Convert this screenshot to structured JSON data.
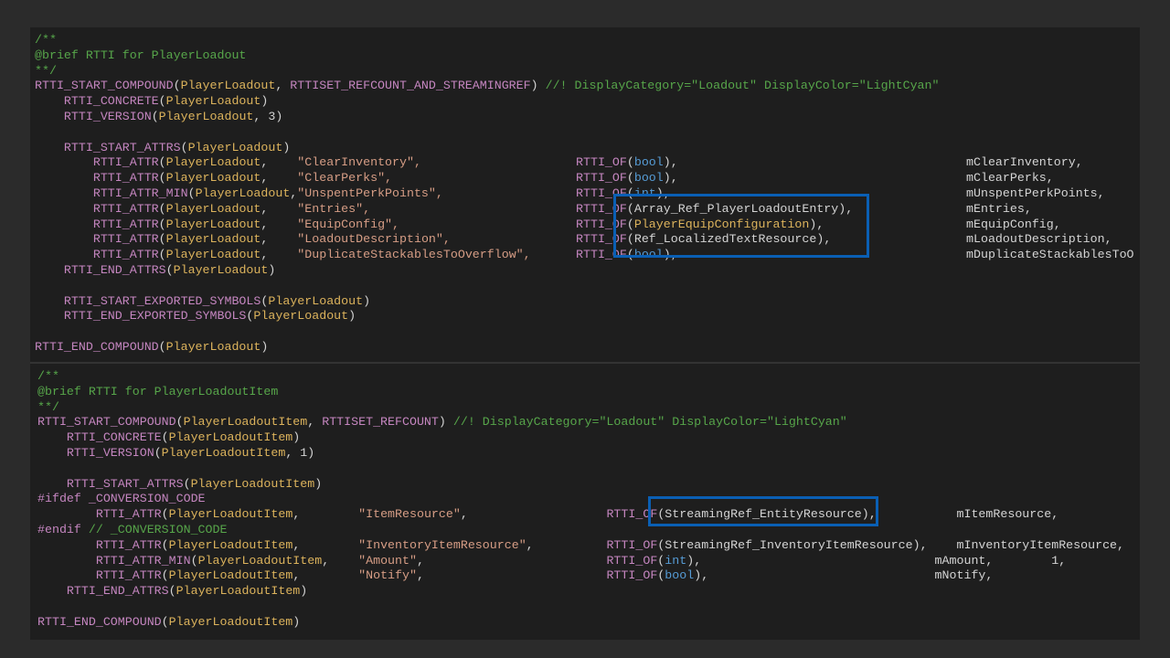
{
  "panel1": {
    "l1": "/**",
    "l2": "@brief RTTI for PlayerLoadout",
    "l3": "**/",
    "l4": [
      {
        "c": "m",
        "t": "RTTI_START_COMPOUND"
      },
      {
        "c": "p",
        "t": "("
      },
      {
        "c": "t",
        "t": "PlayerLoadout"
      },
      {
        "c": "p",
        "t": ", "
      },
      {
        "c": "m",
        "t": "RTTISET_REFCOUNT_AND_STREAMINGREF"
      },
      {
        "c": "p",
        "t": ") "
      },
      {
        "c": "c",
        "t": "//! DisplayCategory=\"Loadout\" DisplayColor=\"LightCyan\""
      }
    ],
    "l5": [
      {
        "c": "p",
        "t": "    "
      },
      {
        "c": "m",
        "t": "RTTI_CONCRETE"
      },
      {
        "c": "p",
        "t": "("
      },
      {
        "c": "t",
        "t": "PlayerLoadout"
      },
      {
        "c": "p",
        "t": ")"
      }
    ],
    "l6": [
      {
        "c": "p",
        "t": "    "
      },
      {
        "c": "m",
        "t": "RTTI_VERSION"
      },
      {
        "c": "p",
        "t": "("
      },
      {
        "c": "t",
        "t": "PlayerLoadout"
      },
      {
        "c": "p",
        "t": ", 3)"
      }
    ],
    "l8": [
      {
        "c": "p",
        "t": "    "
      },
      {
        "c": "m",
        "t": "RTTI_START_ATTRS"
      },
      {
        "c": "p",
        "t": "("
      },
      {
        "c": "t",
        "t": "PlayerLoadout"
      },
      {
        "c": "p",
        "t": ")"
      }
    ],
    "rows": [
      {
        "macro": "RTTI_ATTR",
        "cls": "PlayerLoadout",
        "sep": ",    ",
        "name": "\"ClearInventory\",",
        "ofpre": "RTTI_OF",
        "type": "bool",
        "typecls": "k",
        "tail": "),",
        "member": "mClearInventory,"
      },
      {
        "macro": "RTTI_ATTR",
        "cls": "PlayerLoadout",
        "sep": ",    ",
        "name": "\"ClearPerks\",",
        "ofpre": "RTTI_OF",
        "type": "bool",
        "typecls": "k",
        "tail": "),",
        "member": "mClearPerks,"
      },
      {
        "macro": "RTTI_ATTR_MIN",
        "cls": "PlayerLoadout",
        "sep": ",",
        "name": "\"UnspentPerkPoints\",",
        "ofpre": "RTTI_OF",
        "type": "int",
        "typecls": "k",
        "tail": "),",
        "member": "mUnspentPerkPoints,"
      },
      {
        "macro": "RTTI_ATTR",
        "cls": "PlayerLoadout",
        "sep": ",    ",
        "name": "\"Entries\",",
        "ofpre": "RTTI_OF",
        "type": "Array_Ref_PlayerLoadoutEntry",
        "typecls": "n",
        "tail": "),",
        "member": "mEntries,"
      },
      {
        "macro": "RTTI_ATTR",
        "cls": "PlayerLoadout",
        "sep": ",    ",
        "name": "\"EquipConfig\",",
        "ofpre": "RTTI_OF",
        "type": "PlayerEquipConfiguration",
        "typecls": "t",
        "tail": "),",
        "member": "mEquipConfig,"
      },
      {
        "macro": "RTTI_ATTR",
        "cls": "PlayerLoadout",
        "sep": ",    ",
        "name": "\"LoadoutDescription\",",
        "ofpre": "RTTI_OF",
        "type": "Ref_LocalizedTextResource",
        "typecls": "n",
        "tail": "),",
        "member": "mLoadoutDescription,"
      },
      {
        "macro": "RTTI_ATTR",
        "cls": "PlayerLoadout",
        "sep": ",    ",
        "name": "\"DuplicateStackablesToOverflow\",",
        "ofpre": "RTTI_OF",
        "type": "bool",
        "typecls": "k",
        "tail": "),",
        "member": "mDuplicateStackablesToO"
      }
    ],
    "l16": [
      {
        "c": "p",
        "t": "    "
      },
      {
        "c": "m",
        "t": "RTTI_END_ATTRS"
      },
      {
        "c": "p",
        "t": "("
      },
      {
        "c": "t",
        "t": "PlayerLoadout"
      },
      {
        "c": "p",
        "t": ")"
      }
    ],
    "l18": [
      {
        "c": "p",
        "t": "    "
      },
      {
        "c": "m",
        "t": "RTTI_START_EXPORTED_SYMBOLS"
      },
      {
        "c": "p",
        "t": "("
      },
      {
        "c": "t",
        "t": "PlayerLoadout"
      },
      {
        "c": "p",
        "t": ")"
      }
    ],
    "l19": [
      {
        "c": "p",
        "t": "    "
      },
      {
        "c": "m",
        "t": "RTTI_END_EXPORTED_SYMBOLS"
      },
      {
        "c": "p",
        "t": "("
      },
      {
        "c": "t",
        "t": "PlayerLoadout"
      },
      {
        "c": "p",
        "t": ")"
      }
    ],
    "l21": [
      {
        "c": "m",
        "t": "RTTI_END_COMPOUND"
      },
      {
        "c": "p",
        "t": "("
      },
      {
        "c": "t",
        "t": "PlayerLoadout"
      },
      {
        "c": "p",
        "t": ")"
      }
    ]
  },
  "panel2": {
    "l1": "/**",
    "l2": "@brief RTTI for PlayerLoadoutItem",
    "l3": "**/",
    "l4": [
      {
        "c": "m",
        "t": "RTTI_START_COMPOUND"
      },
      {
        "c": "p",
        "t": "("
      },
      {
        "c": "t",
        "t": "PlayerLoadoutItem"
      },
      {
        "c": "p",
        "t": ", "
      },
      {
        "c": "m",
        "t": "RTTISET_REFCOUNT"
      },
      {
        "c": "p",
        "t": ") "
      },
      {
        "c": "c",
        "t": "//! DisplayCategory=\"Loadout\" DisplayColor=\"LightCyan\""
      }
    ],
    "l5": [
      {
        "c": "p",
        "t": "    "
      },
      {
        "c": "m",
        "t": "RTTI_CONCRETE"
      },
      {
        "c": "p",
        "t": "("
      },
      {
        "c": "t",
        "t": "PlayerLoadoutItem"
      },
      {
        "c": "p",
        "t": ")"
      }
    ],
    "l6": [
      {
        "c": "p",
        "t": "    "
      },
      {
        "c": "m",
        "t": "RTTI_VERSION"
      },
      {
        "c": "p",
        "t": "("
      },
      {
        "c": "t",
        "t": "PlayerLoadoutItem"
      },
      {
        "c": "p",
        "t": ", 1)"
      }
    ],
    "l8": [
      {
        "c": "p",
        "t": "    "
      },
      {
        "c": "m",
        "t": "RTTI_START_ATTRS"
      },
      {
        "c": "p",
        "t": "("
      },
      {
        "c": "t",
        "t": "PlayerLoadoutItem"
      },
      {
        "c": "p",
        "t": ")"
      }
    ],
    "l9": [
      {
        "c": "m",
        "t": "#ifdef "
      },
      {
        "c": "m",
        "t": "_CONVERSION_CODE"
      }
    ],
    "l10": [
      {
        "c": "p",
        "t": "        "
      },
      {
        "c": "m",
        "t": "RTTI_ATTR"
      },
      {
        "c": "p",
        "t": "("
      },
      {
        "c": "t",
        "t": "PlayerLoadoutItem"
      },
      {
        "c": "p",
        "t": ",        "
      },
      {
        "c": "s",
        "t": "\"ItemResource\""
      },
      {
        "c": "p",
        "t": ",                   "
      },
      {
        "c": "m",
        "t": "RTTI_OF"
      },
      {
        "c": "p",
        "t": "(StreamingRef_EntityResource),           "
      },
      {
        "c": "n",
        "t": "mItemResource,"
      }
    ],
    "l11": [
      {
        "c": "m",
        "t": "#endif "
      },
      {
        "c": "c",
        "t": "// _CONVERSION_CODE"
      }
    ],
    "l12": [
      {
        "c": "p",
        "t": "        "
      },
      {
        "c": "m",
        "t": "RTTI_ATTR"
      },
      {
        "c": "p",
        "t": "("
      },
      {
        "c": "t",
        "t": "PlayerLoadoutItem"
      },
      {
        "c": "p",
        "t": ",        "
      },
      {
        "c": "s",
        "t": "\"InventoryItemResource\""
      },
      {
        "c": "p",
        "t": ",          "
      },
      {
        "c": "m",
        "t": "RTTI_OF"
      },
      {
        "c": "p",
        "t": "(StreamingRef_InventoryItemResource),    "
      },
      {
        "c": "n",
        "t": "mInventoryItemResource,"
      }
    ],
    "l13": [
      {
        "c": "p",
        "t": "        "
      },
      {
        "c": "m",
        "t": "RTTI_ATTR_MIN"
      },
      {
        "c": "p",
        "t": "("
      },
      {
        "c": "t",
        "t": "PlayerLoadoutItem"
      },
      {
        "c": "p",
        "t": ",    "
      },
      {
        "c": "s",
        "t": "\"Amount\""
      },
      {
        "c": "p",
        "t": ",                         "
      },
      {
        "c": "m",
        "t": "RTTI_OF"
      },
      {
        "c": "p",
        "t": "("
      },
      {
        "c": "k",
        "t": "int"
      },
      {
        "c": "p",
        "t": "),                                "
      },
      {
        "c": "n",
        "t": "mAmount,        1,"
      }
    ],
    "l14": [
      {
        "c": "p",
        "t": "        "
      },
      {
        "c": "m",
        "t": "RTTI_ATTR"
      },
      {
        "c": "p",
        "t": "("
      },
      {
        "c": "t",
        "t": "PlayerLoadoutItem"
      },
      {
        "c": "p",
        "t": ",        "
      },
      {
        "c": "s",
        "t": "\"Notify\""
      },
      {
        "c": "p",
        "t": ",                         "
      },
      {
        "c": "m",
        "t": "RTTI_OF"
      },
      {
        "c": "p",
        "t": "("
      },
      {
        "c": "k",
        "t": "bool"
      },
      {
        "c": "p",
        "t": "),                               "
      },
      {
        "c": "n",
        "t": "mNotify,"
      }
    ],
    "l15": [
      {
        "c": "p",
        "t": "    "
      },
      {
        "c": "m",
        "t": "RTTI_END_ATTRS"
      },
      {
        "c": "p",
        "t": "("
      },
      {
        "c": "t",
        "t": "PlayerLoadoutItem"
      },
      {
        "c": "p",
        "t": ")"
      }
    ],
    "l17": [
      {
        "c": "m",
        "t": "RTTI_END_COMPOUND"
      },
      {
        "c": "p",
        "t": "("
      },
      {
        "c": "t",
        "t": "PlayerLoadoutItem"
      },
      {
        "c": "p",
        "t": ")"
      }
    ]
  },
  "colors": {
    "highlight": "#0a5fb4",
    "comment": "#57a64a",
    "macro": "#c586c0",
    "typename": "#dcb35c",
    "string": "#d69d85",
    "keyword": "#569cd6"
  }
}
